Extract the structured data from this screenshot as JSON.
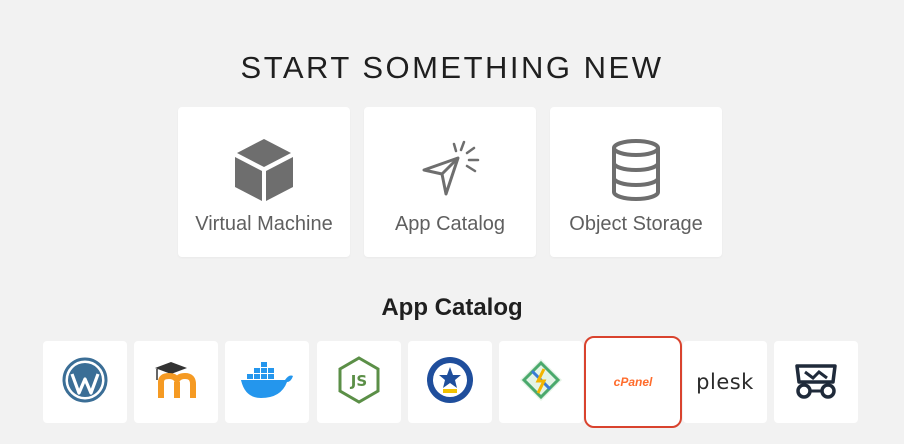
{
  "headline": "START SOMETHING NEW",
  "start_cards": [
    {
      "label": "Virtual Machine",
      "icon": "cube-icon"
    },
    {
      "label": "App Catalog",
      "icon": "cursor-click-icon"
    },
    {
      "label": "Object Storage",
      "icon": "database-icon"
    }
  ],
  "app_catalog": {
    "title": "App Catalog",
    "apps": [
      {
        "icon": "wordpress-icon"
      },
      {
        "icon": "moodle-icon"
      },
      {
        "icon": "docker-icon"
      },
      {
        "icon": "nodejs-icon"
      },
      {
        "icon": "indonesian-emblem-icon"
      },
      {
        "icon": "jitsi-icon"
      },
      {
        "icon": "cpanel-icon",
        "text": "cPanel",
        "selected": true
      },
      {
        "icon": "plesk-icon",
        "text": "plesk"
      },
      {
        "icon": "pod-icon"
      }
    ]
  },
  "colors": {
    "background": "#f2f2f2",
    "icon_gray": "#6e6e6e",
    "selection_border": "#d9432e",
    "wordpress": "#3b6e96",
    "docker": "#2496ed",
    "nodejs": "#5b8f47",
    "cpanel": "#ff6c2c"
  }
}
